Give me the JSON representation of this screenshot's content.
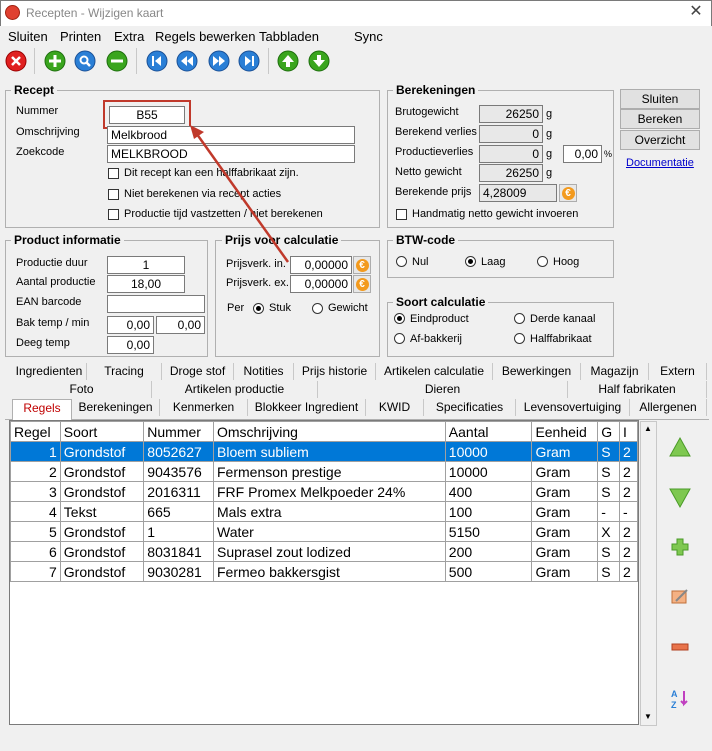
{
  "window": {
    "title": "Recepten - Wijzigen kaart",
    "close": "✕"
  },
  "menu": [
    "Sluiten",
    "Printen",
    "Extra",
    "Regels bewerken",
    "Tabbladen",
    "Sync"
  ],
  "recept": {
    "title": "Recept",
    "nummer_label": "Nummer",
    "nummer": "B55",
    "omschrijving_label": "Omschrijving",
    "omschrijving": "Melkbrood",
    "zoekcode_label": "Zoekcode",
    "zoekcode": "MELKBROOD",
    "chk1": "Dit recept kan een halffabrikaat zijn.",
    "chk2": "Niet berekenen via recept acties",
    "chk3": "Productie tijd vastzetten / niet berekenen"
  },
  "berekeningen": {
    "title": "Berekeningen",
    "bruto_label": "Brutogewicht",
    "bruto": "26250",
    "bruto_unit": "g",
    "verlies_label": "Berekend verlies",
    "verlies": "0",
    "verlies_unit": "g",
    "prodverlies_label": "Productieverlies",
    "prodverlies": "0",
    "prodverlies_unit": "g",
    "prodverlies_pct": "0,00",
    "pct": "%",
    "netto_label": "Netto gewicht",
    "netto": "26250",
    "netto_unit": "g",
    "prijs_label": "Berekende prijs",
    "prijs": "4,28009",
    "handmatig": "Handmatig netto gewicht invoeren"
  },
  "buttons": {
    "sluiten": "Sluiten",
    "bereken": "Bereken",
    "overzicht": "Overzicht",
    "documentatie": "Documentatie"
  },
  "product": {
    "title": "Product informatie",
    "duur_label": "Productie duur",
    "duur": "1",
    "aantal_label": "Aantal productie",
    "aantal": "18,00",
    "ean_label": "EAN barcode",
    "ean": "",
    "bak_label": "Bak temp / min",
    "bak1": "0,00",
    "bak2": "0,00",
    "deeg_label": "Deeg temp",
    "deeg": "0,00"
  },
  "prijs": {
    "title": "Prijs voor calculatie",
    "in_label": "Prijsverk. in.",
    "in": "0,00000",
    "ex_label": "Prijsverk. ex.",
    "ex": "0,00000",
    "per_label": "Per",
    "stuk": "Stuk",
    "gewicht": "Gewicht"
  },
  "btw": {
    "title": "BTW-code",
    "nul": "Nul",
    "laag": "Laag",
    "hoog": "Hoog"
  },
  "soort": {
    "title": "Soort calculatie",
    "eind": "Eindproduct",
    "derde": "Derde kanaal",
    "af": "Af-bakkerij",
    "half": "Halffabrikaat"
  },
  "tabs_row1": [
    "Ingredienten",
    "Tracing",
    "Droge stof",
    "Notities",
    "Prijs historie",
    "Artikelen calculatie",
    "Bewerkingen",
    "Magazijn",
    "Extern"
  ],
  "tabs_row2": [
    "Foto",
    "Artikelen productie",
    "Dieren",
    "Half fabrikaten"
  ],
  "tabs_row3": [
    "Regels",
    "Berekeningen",
    "Kenmerken",
    "Blokkeer Ingredient",
    "KWID",
    "Specificaties",
    "Levensovertuiging",
    "Allergenen"
  ],
  "grid": {
    "columns": [
      "Regel",
      "Soort",
      "Nummer",
      "Omschrijving",
      "Aantal",
      "Eenheid",
      "G",
      "I"
    ],
    "rows": [
      [
        "1",
        "Grondstof",
        "8052627",
        "Bloem subliem",
        "10000",
        "Gram",
        "S",
        "2"
      ],
      [
        "2",
        "Grondstof",
        "9043576",
        "Fermenson prestige",
        "10000",
        "Gram",
        "S",
        "2"
      ],
      [
        "3",
        "Grondstof",
        "2016311",
        "FRF Promex Melkpoeder 24%",
        "400",
        "Gram",
        "S",
        "2"
      ],
      [
        "4",
        "Tekst",
        "665",
        "Mals extra",
        "100",
        "Gram",
        "-",
        "-"
      ],
      [
        "5",
        "Grondstof",
        "1",
        "Water",
        "5150",
        "Gram",
        "X",
        "2"
      ],
      [
        "6",
        "Grondstof",
        "8031841",
        "Suprasel zout lodized",
        "200",
        "Gram",
        "S",
        "2"
      ],
      [
        "7",
        "Grondstof",
        "9030281",
        "Fermeo bakkersgist",
        "500",
        "Gram",
        "S",
        "2"
      ]
    ]
  },
  "colors": {
    "accent": "#0078d7",
    "tab_selected": "#c00000",
    "callout": "#c0392b",
    "euro": "#f39a1d"
  }
}
